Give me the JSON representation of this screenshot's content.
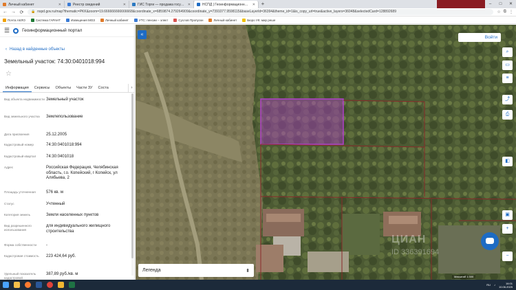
{
  "browser": {
    "tabs": [
      {
        "label": "Личный кабинет",
        "color": "#e07a29"
      },
      {
        "label": "Реестр сведений",
        "color": "#3a7bd5"
      },
      {
        "label": "ГИС Торги — продажа государст",
        "color": "#2b79c2"
      },
      {
        "label": "НСПД | Геоинформационный с",
        "color": "#1d6bc4",
        "active": true
      }
    ],
    "new_tab": "+",
    "window_controls": [
      "–",
      "□",
      "✕"
    ],
    "url": "nspd.gov.ru/map?thematic=PKK&zoom=19.666666666666668&coordinate_x=6859874.279264909&coordinate_y=7391077.9598115&baseLayerId=36394&theme_id=1&is_copy_url=true&active_layers=36048&selectedCard=128892689",
    "bookmarks": [
      {
        "label": "Почта АКЛО",
        "color": "#f0a000"
      },
      {
        "label": "Система ГАРАНТ",
        "color": "#1e7a36"
      },
      {
        "label": "Извещения МОЗ",
        "color": "#3a7bd5"
      },
      {
        "label": "Личный кабинет",
        "color": "#e07a29"
      },
      {
        "label": "УТС: пенсии – элект",
        "color": "#3a7bd5"
      },
      {
        "label": "Суслов Пропускн",
        "color": "#d9534f"
      },
      {
        "label": "Личный кабинет",
        "color": "#e07a29"
      },
      {
        "label": "Бюро УК: мир реше",
        "color": "#f0c000"
      }
    ]
  },
  "panel": {
    "portal_title": "Геоинформационный портал",
    "back_link": "Назад в найденные объекты",
    "object_title": "Земельный участок: 74:30:0401018:994",
    "tabs": [
      "Информация",
      "Сервисы",
      "Объекты",
      "Части ЗУ",
      "Соста"
    ],
    "rows": [
      {
        "label": "Вид объекта недвижимости",
        "value": "Земельный участок"
      },
      {
        "label": "Вид земельного участка",
        "value": "Землепользование"
      },
      {
        "label": "Дата присвоения",
        "value": "25.12.2005"
      },
      {
        "label": "Кадастровый номер",
        "value": "74:30:0401018:994"
      },
      {
        "label": "Кадастровый квартал",
        "value": "74:30:0401018"
      },
      {
        "label": "Адрес",
        "value": "Российская Федерация, Челябинская область, г.о. Копейский, г Копейск, ул Алябьева, 2"
      },
      {
        "label": "Площадь уточненная",
        "value": "576 кв. м"
      },
      {
        "label": "Статус",
        "value": "Учтенный"
      },
      {
        "label": "Категория земель",
        "value": "Земли населенных пунктов"
      },
      {
        "label": "Вид разрешенного использования",
        "value": "для индивидуального жилищного строительства"
      },
      {
        "label": "Форма собственности",
        "value": "-"
      },
      {
        "label": "Кадастровая стоимость",
        "value": "223 424,64 руб."
      },
      {
        "label": "Удельный показатель кадастровой",
        "value": "387,89 руб./кв. м"
      }
    ]
  },
  "map": {
    "login": "Войти",
    "legend": "Легенда",
    "legend_arrow": "⬍",
    "scale": "Масштаб 1:300",
    "watermark": "ЦИАН",
    "watermark_id": "ID 336391694"
  },
  "taskbar": {
    "time": "16:01",
    "date": "10.06.2025",
    "lang": "RU"
  },
  "colors": {
    "accent": "#1d6bc4",
    "highlight_parcel": "#b040c8",
    "parcel_border": "#8a2a2a"
  }
}
